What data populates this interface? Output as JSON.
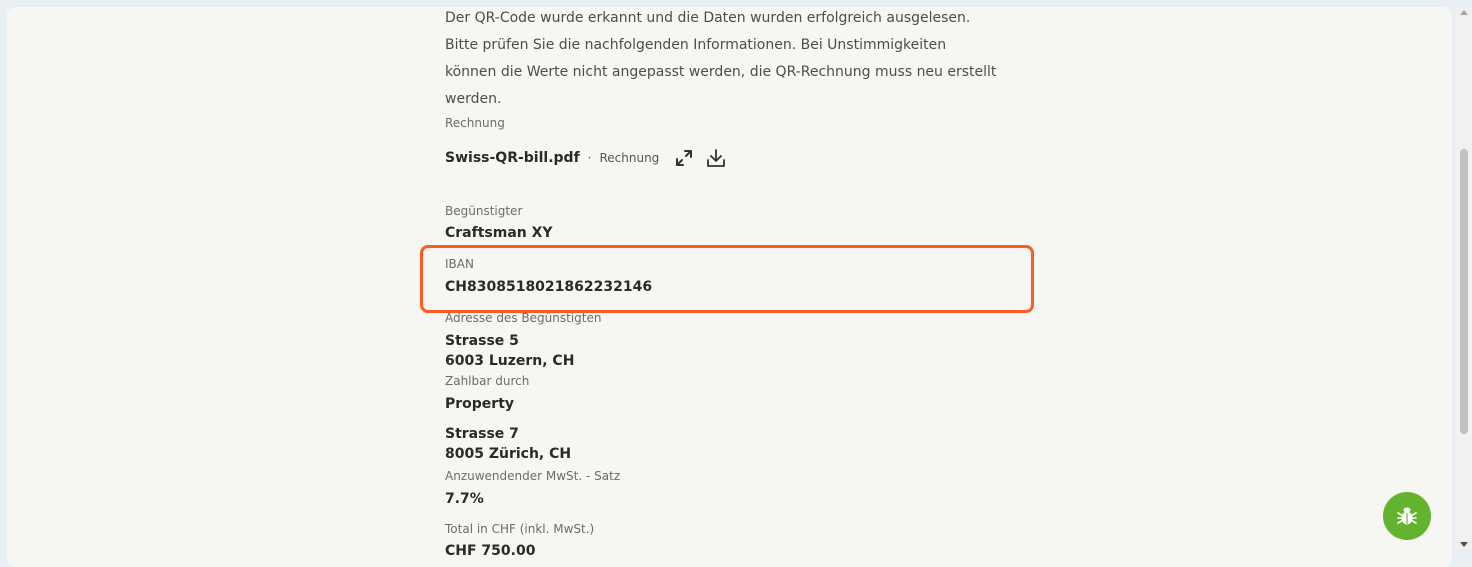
{
  "intro": {
    "lines": [
      "Der QR-Code wurde erkannt und die Daten wurden erfolgreich ausgelesen.",
      "Bitte prüfen Sie die nachfolgenden Informationen. Bei Unstimmigkeiten",
      "können die Werte nicht angepasst werden, die QR-Rechnung muss neu erstellt",
      "werden."
    ]
  },
  "invoice": {
    "label": "Rechnung",
    "file_name": "Swiss-QR-bill.pdf",
    "separator": "·",
    "file_type": "Rechnung",
    "expand_icon": "expand-icon",
    "download_icon": "download-icon"
  },
  "beneficiary": {
    "label": "Begünstigter",
    "value": "Craftsman XY"
  },
  "iban": {
    "label": "IBAN",
    "value": "CH8308518021862232146",
    "highlight_color": "#ff5a1f"
  },
  "beneficiary_address": {
    "label": "Adresse des Begünstigten",
    "street": "Strasse 5",
    "city": "6003 Luzern, CH"
  },
  "payable_by": {
    "label": "Zahlbar durch",
    "name": "Property",
    "street": "Strasse 7",
    "city": "8005 Zürich, CH"
  },
  "vat": {
    "label": "Anzuwendender MwSt. - Satz",
    "value": "7.7%"
  },
  "total": {
    "label": "Total in CHF (inkl. MwSt.)",
    "value": "CHF 750.00"
  },
  "bug_button": {
    "icon": "bug-icon",
    "color": "#63b32e"
  }
}
